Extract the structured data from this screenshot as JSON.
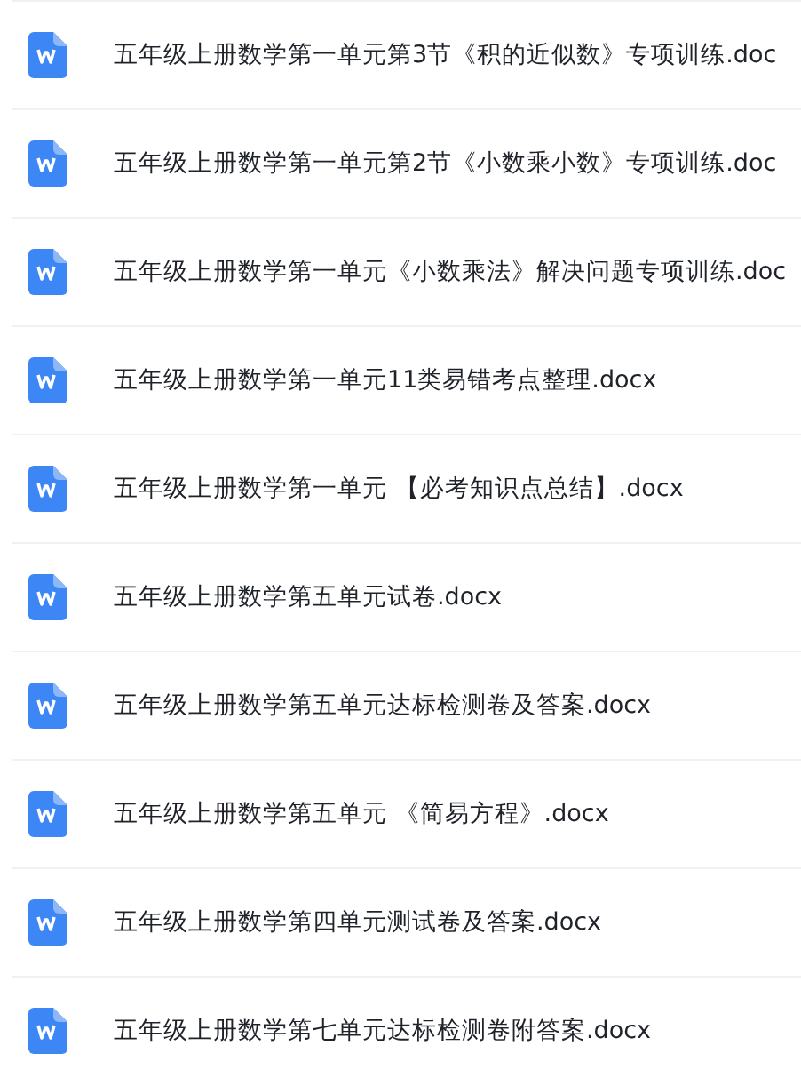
{
  "files": [
    {
      "name": "五年级上册数学第一单元第3节《积的近似数》专项训练.doc"
    },
    {
      "name": "五年级上册数学第一单元第2节《小数乘小数》专项训练.doc"
    },
    {
      "name": "五年级上册数学第一单元《小数乘法》解决问题专项训练.doc"
    },
    {
      "name": "五年级上册数学第一单元11类易错考点整理.docx"
    },
    {
      "name": "五年级上册数学第一单元 【必考知识点总结】.docx"
    },
    {
      "name": "五年级上册数学第五单元试卷.docx"
    },
    {
      "name": "五年级上册数学第五单元达标检测卷及答案.docx"
    },
    {
      "name": "五年级上册数学第五单元 《简易方程》.docx"
    },
    {
      "name": "五年级上册数学第四单元测试卷及答案.docx"
    },
    {
      "name": "五年级上册数学第七单元达标检测卷附答案.docx"
    }
  ]
}
